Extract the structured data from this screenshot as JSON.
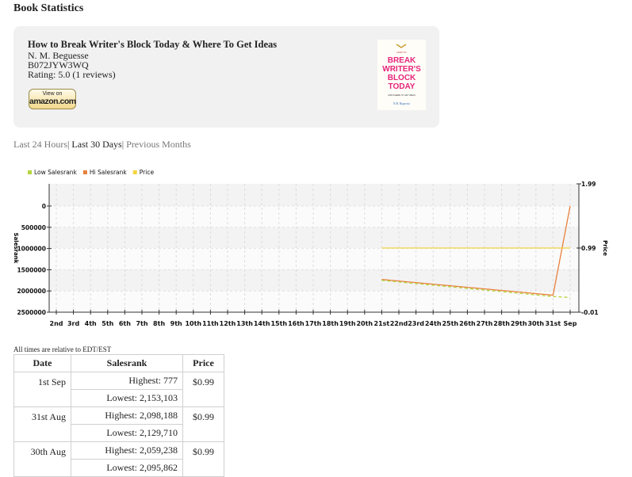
{
  "page_title": "Book Statistics",
  "book": {
    "title": "How to Break Writer's Block Today & Where To Get Ideas",
    "author": "N. M. Beguesse",
    "asin": "B072JYW3WQ",
    "rating": "Rating: 5.0  (1 reviews)"
  },
  "amazon_button": {
    "top": "View on",
    "brand": "amazon.com"
  },
  "cover": {
    "small_top": "HOW TO",
    "line1": "BREAK",
    "line2": "WRITER'S",
    "line3": "BLOCK",
    "line4": "TODAY",
    "subtitle": "AND WHERE TO GET IDEAS",
    "author_sig": "N.M. Beguesse"
  },
  "tabs": [
    "Last 24 Hours",
    "Last 30 Days",
    "Previous Months"
  ],
  "tab_separator": "|",
  "chart_data": {
    "type": "line",
    "legend": [
      "Low Salesrank",
      "Hi Salesrank",
      "Price"
    ],
    "legend_placement": "top-left",
    "colors": {
      "low": "#b5d43c",
      "hi": "#e8803c",
      "price": "#f4d43c"
    },
    "categories": [
      "2nd",
      "3rd",
      "4th",
      "5th",
      "6th",
      "7th",
      "8th",
      "9th",
      "10th",
      "11th",
      "12th",
      "13th",
      "14th",
      "15th",
      "16th",
      "17th",
      "18th",
      "19th",
      "20th",
      "21st",
      "22nd",
      "23rd",
      "24th",
      "25th",
      "26th",
      "27th",
      "28th",
      "29th",
      "30th",
      "31st",
      "Sep"
    ],
    "y_left_ticks": [
      "0",
      "500000",
      "1000000",
      "1500000",
      "2000000",
      "2500000"
    ],
    "y_left_label": "Salesrank",
    "y_left_range": [
      0,
      2500000
    ],
    "y_right_ticks": [
      "1.99",
      "0.99",
      "-0.01"
    ],
    "y_right_label": "Price",
    "y_right_range": [
      -0.01,
      1.99
    ],
    "grid": true,
    "series": [
      {
        "name": "Hi Salesrank",
        "x_index": [
          19,
          29,
          30
        ],
        "values": [
          1730000,
          2098188,
          777
        ]
      },
      {
        "name": "Low Salesrank",
        "x_index": [
          19,
          29,
          30
        ],
        "values": [
          1750000,
          2129710,
          2153103
        ]
      },
      {
        "name": "Price",
        "x_index": [
          19,
          30
        ],
        "values": [
          0.99,
          0.99
        ]
      }
    ]
  },
  "timezone_note": "All times are relative to EDT/EST",
  "table": {
    "headers": [
      "Date",
      "Salesrank",
      "Price"
    ],
    "rows": [
      {
        "date": "1st Sep",
        "highest": "Highest: 777",
        "lowest": "Lowest: 2,153,103",
        "price": "$0.99"
      },
      {
        "date": "31st Aug",
        "highest": "Highest: 2,098,188",
        "lowest": "Lowest: 2,129,710",
        "price": "$0.99"
      },
      {
        "date": "30th Aug",
        "highest": "Highest: 2,059,238",
        "lowest": "Lowest: 2,095,862",
        "price": "$0.99"
      }
    ]
  }
}
